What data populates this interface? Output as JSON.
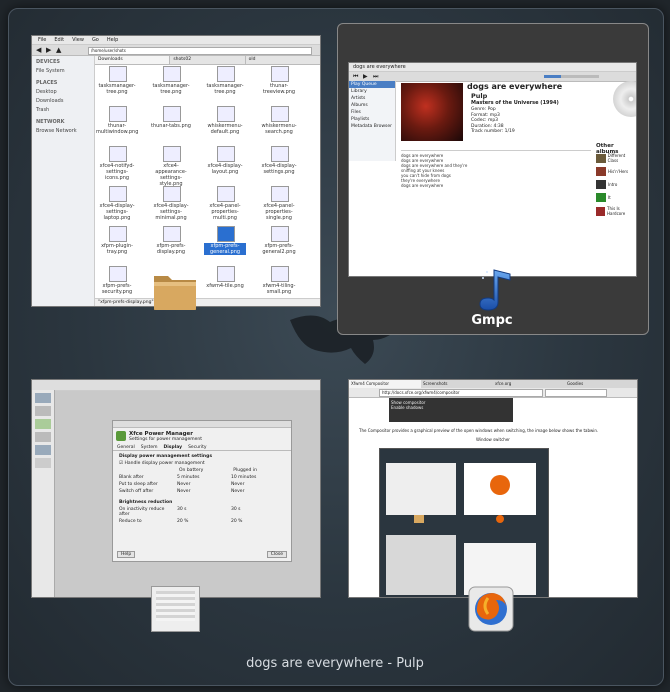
{
  "switcher": {
    "selected_app_name": "Gmpc",
    "caption": "dogs are everywhere - Pulp"
  },
  "thunar": {
    "menu": [
      "File",
      "Edit",
      "View",
      "Go",
      "Help"
    ],
    "path": "/home/user/shots",
    "sidebar_devices_header": "DEVICES",
    "sidebar_devices": [
      "File System"
    ],
    "sidebar_places_header": "PLACES",
    "sidebar_places": [
      "Desktop",
      "Downloads",
      "Trash"
    ],
    "sidebar_network_header": "NETWORK",
    "sidebar_network": [
      "Browse Network"
    ],
    "tabs": [
      "Downloads",
      "shots02",
      "old"
    ],
    "files": [
      "tasksmanager-tree.png",
      "tasksmanager-tree.png",
      "tasksmanager-tree.png",
      "thunar-treeview.png",
      "thunar-multiwindow.png",
      "thunar-tabs.png",
      "whiskermenu-default.png",
      "whiskermenu-search.png",
      "xfce4-notifyd-settings-icons.png",
      "xfce4-appearance-settings-style.png",
      "xfce4-display-layout.png",
      "xfce4-display-settings.png",
      "xfce4-display-settings-laptop.png",
      "xfce4-display-settings-minimal.png",
      "xfce4-panel-properties-multi.png",
      "xfce4-panel-properties-single.png",
      "xfpm-plugin-tray.png",
      "xfpm-prefs-display.png",
      "xfpm-prefs-general.png",
      "xfpm-prefs-general2.png",
      "xfpm-prefs-security.png",
      "",
      "xfwm4-tile.png",
      "xfwm4-tiling-small.png"
    ],
    "status": "\"xfpm-prefs-display.png\" (image, 1.4 MB)"
  },
  "gmpc": {
    "window_title": "dogs are everywhere",
    "song_title": "dogs are everywhere",
    "artist": "Pulp",
    "album": "Masters of the Universe (1994)",
    "info_rows": [
      "Genre: Pop",
      "Format: mp3",
      "Codec: mp3",
      "Duration: 4:38",
      "Track number: 1/19"
    ],
    "side_menu": [
      "Play Queue",
      "Library",
      "Artists",
      "Albums",
      "Files",
      "Playlists",
      "Metadata Browser",
      "Other albums"
    ],
    "other_albums_header": "Other albums",
    "other_albums": [
      "Different Class",
      "His'n'Hers",
      "Intro",
      "It",
      "This Is Hardcore"
    ],
    "lyrics": [
      "dogs are everywhere",
      "dogs are everywhere",
      "dogs are everywhere and they're",
      "sniffing at your knees",
      "you can't hide from dogs",
      "they're everywhere",
      "dogs are everywhere"
    ]
  },
  "power_manager": {
    "dialog_title": "Xfce Power Manager",
    "dialog_subtitle": "Settings for power management",
    "tabs": [
      "General",
      "System",
      "Display",
      "Security"
    ],
    "section_display": "Display power management settings",
    "handle_display": "Handle display power management",
    "col_on_battery": "On battery",
    "col_plugged_in": "Plugged in",
    "rows": [
      {
        "label": "Blank after",
        "battery": "5 minutes",
        "plugged": "10 minutes"
      },
      {
        "label": "Put to sleep after",
        "battery": "Never",
        "plugged": "Never"
      },
      {
        "label": "Switch off after",
        "battery": "Never",
        "plugged": "Never"
      }
    ],
    "section_brightness": "Brightness reduction",
    "brightness_row": "On inactivity reduce after",
    "brightness_values": [
      "30 s",
      "30 s"
    ],
    "reduce_to": "Reduce to",
    "reduce_values": [
      "20 %",
      "20 %"
    ],
    "help_button": "Help",
    "close_button": "Close"
  },
  "firefox": {
    "tabs": [
      "Xfwm4 Compositor",
      "Screenshots",
      "xfce.org",
      "Goodies"
    ],
    "url": "http://docs.xfce.org/xfwm4/compositor",
    "body_text": "The Compositor provides a graphical preview of the open windows when switching, the image below shows the tabwin.",
    "figure_caption": "Window switcher",
    "menu_items": [
      "Show compositor",
      "Enable shadows"
    ]
  },
  "accents": {
    "switcher_bg": "#2b363f",
    "selected_bg": "#3a3a3a",
    "folder": "#d8a860",
    "gmpc_blue": "#2a6fd0",
    "firefox_orange": "#e8660c"
  }
}
